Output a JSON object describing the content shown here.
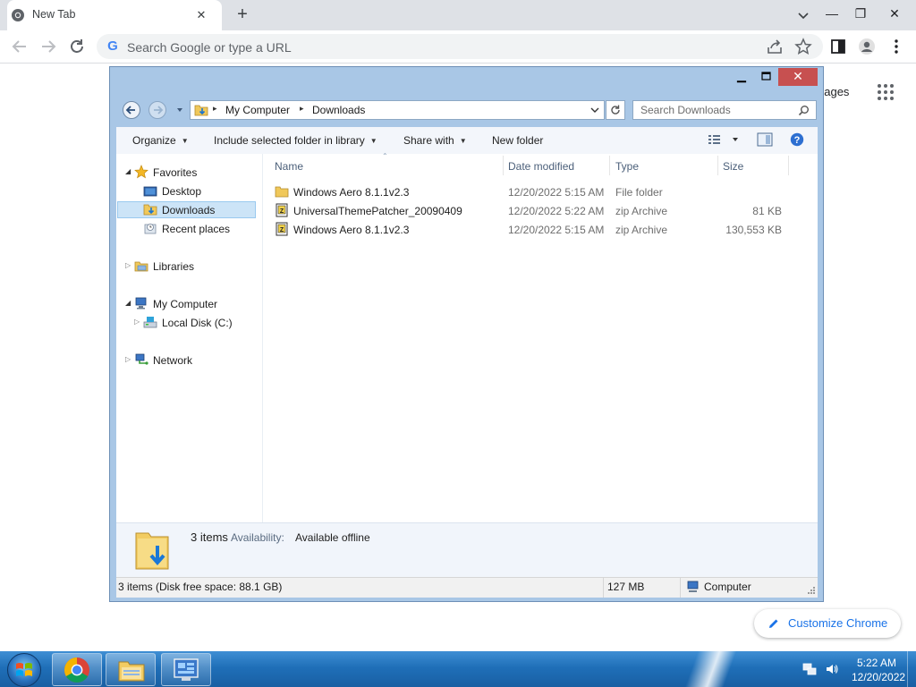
{
  "chrome": {
    "tab_title": "New Tab",
    "omnibox_placeholder": "Search Google or type a URL",
    "ntp_images_partial": "nages",
    "customize_label": "Customize Chrome"
  },
  "explorer": {
    "breadcrumb": [
      "My Computer",
      "Downloads"
    ],
    "search_placeholder": "Search Downloads",
    "commands": {
      "organize": "Organize",
      "include_in_library": "Include selected folder in library",
      "share_with": "Share with",
      "new_folder": "New folder"
    },
    "nav": {
      "favorites": "Favorites",
      "desktop": "Desktop",
      "downloads": "Downloads",
      "recent_places": "Recent places",
      "libraries": "Libraries",
      "my_computer": "My Computer",
      "local_disk": "Local Disk (C:)",
      "network": "Network"
    },
    "columns": [
      "Name",
      "Date modified",
      "Type",
      "Size"
    ],
    "files": [
      {
        "name": "Windows Aero 8.1.1v2.3",
        "date": "12/20/2022 5:15 AM",
        "type": "File folder",
        "size": "",
        "icon": "folder-icon"
      },
      {
        "name": "UniversalThemePatcher_20090409",
        "date": "12/20/2022 5:22 AM",
        "type": "zip Archive",
        "size": "81 KB",
        "icon": "zip-icon"
      },
      {
        "name": "Windows Aero 8.1.1v2.3",
        "date": "12/20/2022 5:15 AM",
        "type": "zip Archive",
        "size": "130,553 KB",
        "icon": "zip-icon"
      }
    ],
    "details": {
      "count": "3 items",
      "availability_label": "Availability:",
      "availability_value": "Available offline"
    },
    "status": {
      "left": "3 items (Disk free space: 88.1 GB)",
      "size": "127 MB",
      "location": "Computer"
    }
  },
  "taskbar": {
    "time": "5:22 AM",
    "date": "12/20/2022"
  }
}
